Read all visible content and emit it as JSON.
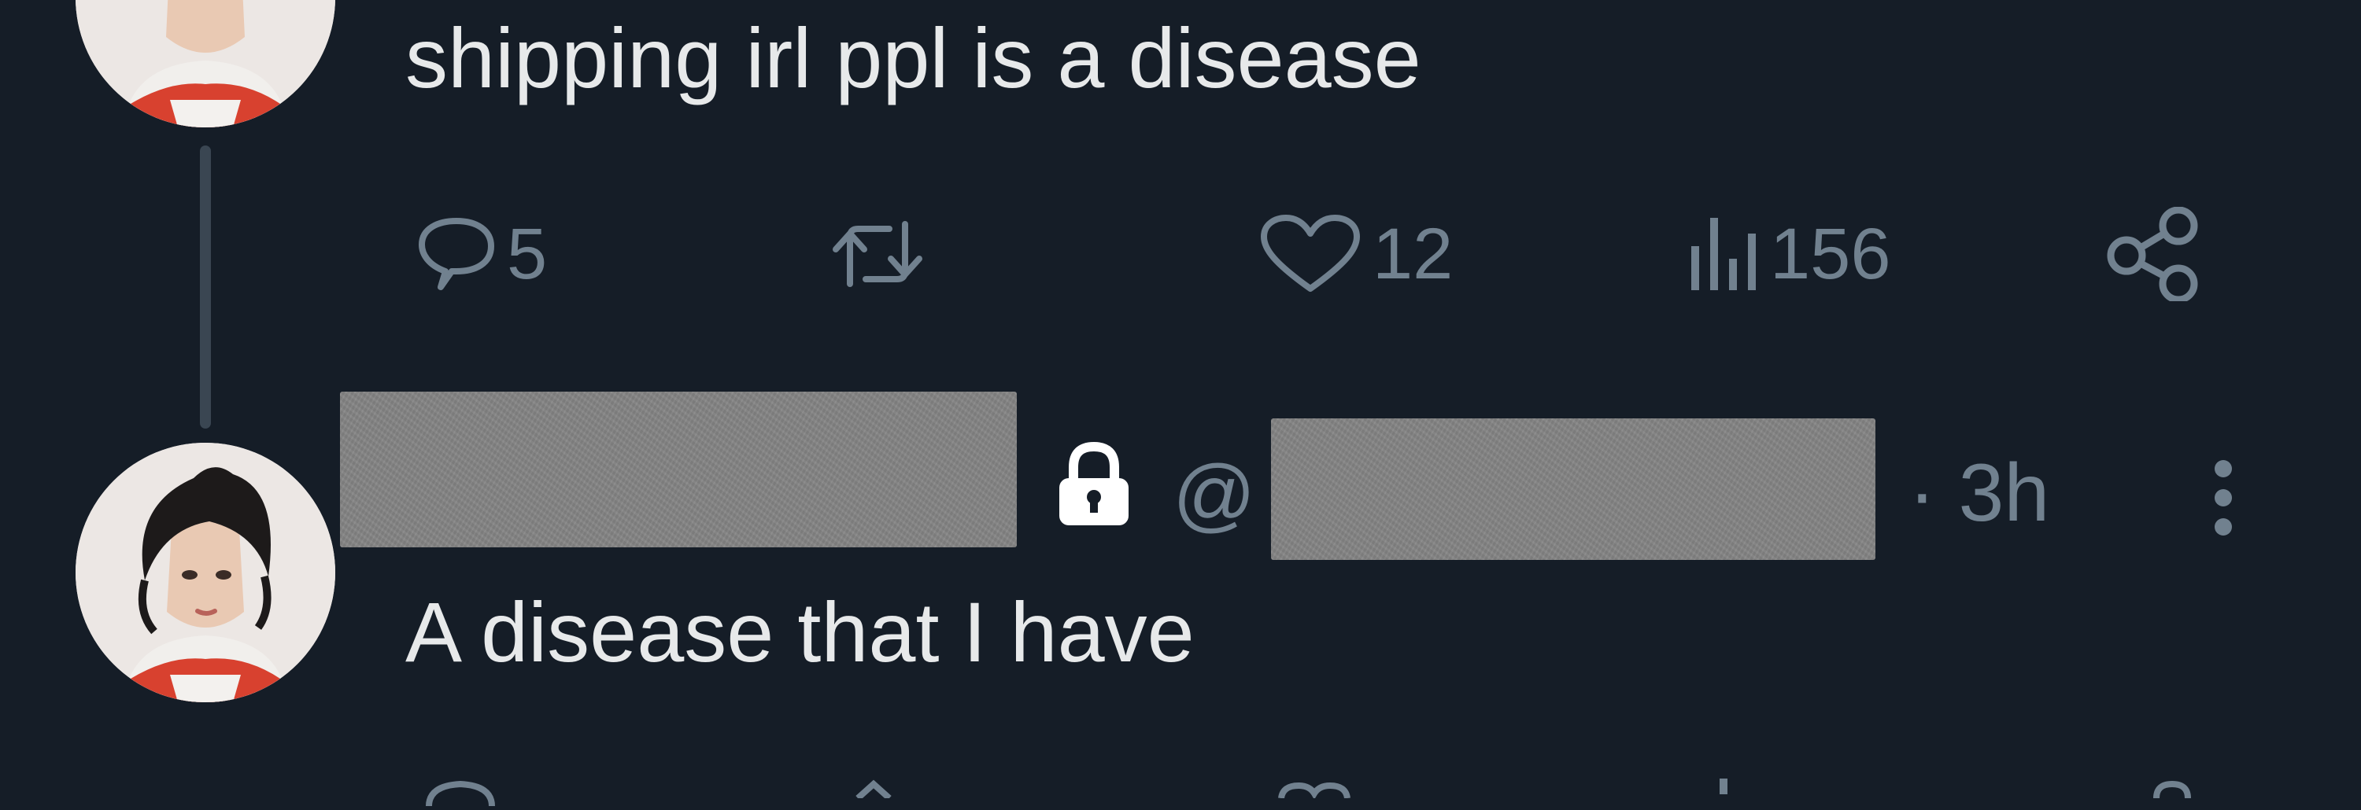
{
  "tweet_1": {
    "text": "shipping irl ppl is a disease",
    "actions": {
      "reply_count": "5",
      "retweet_count": "",
      "like_count": "12",
      "view_count": "156"
    }
  },
  "tweet_2": {
    "at_sign": "@",
    "separator_time": "· 3h",
    "text": "A disease that I have"
  },
  "colors": {
    "background": "#151d27",
    "text": "#e7e9ea",
    "muted": "#71818f",
    "redaction": "#858585"
  },
  "icons": [
    "reply-icon",
    "retweet-icon",
    "like-icon",
    "views-icon",
    "share-icon",
    "lock-icon",
    "more-icon"
  ]
}
